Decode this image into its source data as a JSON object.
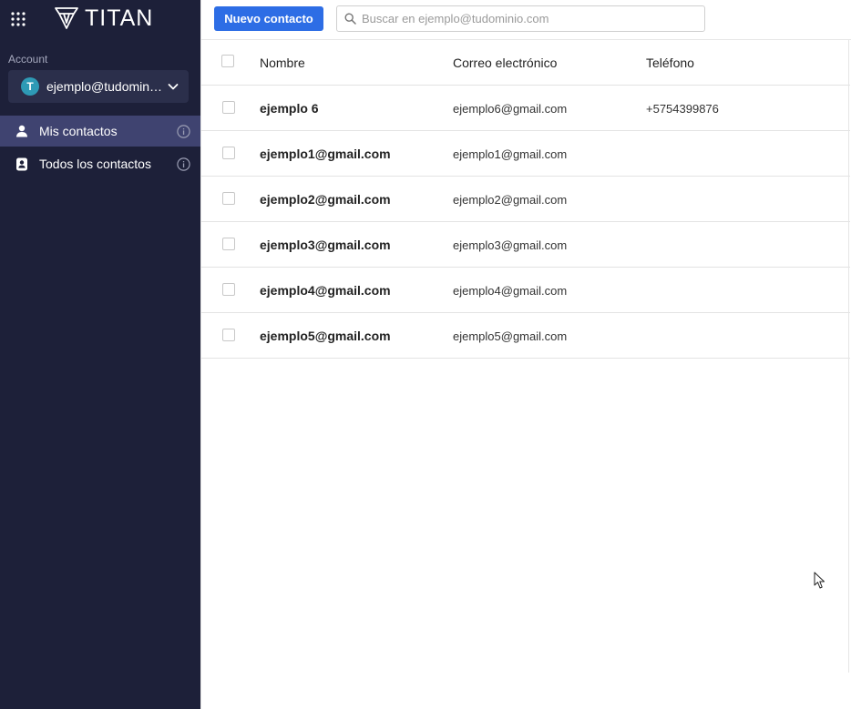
{
  "brand": {
    "logo_text": "TITAN"
  },
  "sidebar": {
    "account_label": "Account",
    "account": {
      "avatar_letter": "T",
      "email": "ejemplo@tudominio.com"
    },
    "items": [
      {
        "label": "Mis contactos",
        "icon": "person-icon",
        "active": true
      },
      {
        "label": "Todos los contactos",
        "icon": "address-book-icon",
        "active": false
      }
    ]
  },
  "toolbar": {
    "new_contact_label": "Nuevo contacto",
    "search_placeholder": "Buscar en ejemplo@tudominio.com"
  },
  "table": {
    "columns": [
      "Nombre",
      "Correo electrónico",
      "Teléfono"
    ],
    "rows": [
      {
        "name": "ejemplo 6",
        "email": "ejemplo6@gmail.com",
        "phone": "+5754399876"
      },
      {
        "name": "ejemplo1@gmail.com",
        "email": "ejemplo1@gmail.com",
        "phone": ""
      },
      {
        "name": "ejemplo2@gmail.com",
        "email": "ejemplo2@gmail.com",
        "phone": ""
      },
      {
        "name": "ejemplo3@gmail.com",
        "email": "ejemplo3@gmail.com",
        "phone": ""
      },
      {
        "name": "ejemplo4@gmail.com",
        "email": "ejemplo4@gmail.com",
        "phone": ""
      },
      {
        "name": "ejemplo5@gmail.com",
        "email": "ejemplo5@gmail.com",
        "phone": ""
      }
    ]
  },
  "colors": {
    "sidebar_bg": "#1d2039",
    "active_item_bg": "#3f4370",
    "account_bg": "#2b2f4b",
    "primary_button": "#2d6de5",
    "avatar_bg": "#2e9ab5"
  }
}
